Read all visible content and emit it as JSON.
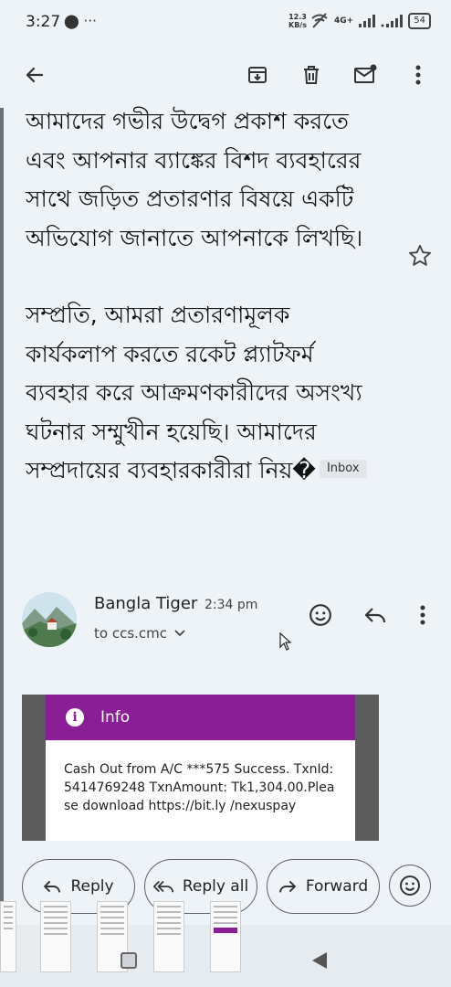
{
  "status_bar": {
    "time": "3:27",
    "left_icons": "⬤ ···",
    "speed_value": "12.3",
    "speed_unit": "KB/s",
    "network_label": "4G+",
    "battery": "54"
  },
  "toolbar": {
    "back_icon": "arrow-back-icon",
    "archive_icon": "archive-icon",
    "delete_icon": "delete-icon",
    "mark_unread_icon": "mark-unread-icon",
    "more_icon": "more-vert-icon"
  },
  "message": {
    "para1": "আমাদের গভীর উদ্বেগ প্রকাশ করতে এবং আপনার ব্যাঙ্কের বিশদ ব্যবহারের সাথে জড়িত প্রতারণার বিষয়ে একটি অভিযোগ জানাতে আপনাকে লিখছি।",
    "para2": "সম্প্রতি, আমরা প্রতারণামূলক কার্যকলাপ করতে রকেট প্ল্যাটফর্ম ব্যবহার করে আক্রমণকারীদের অসংখ্য ঘটনার সম্মুখীন হয়েছি। আমাদের সম্প্রদায়ের ব্যবহারকারীরা নিয়�",
    "label_chip": "Inbox"
  },
  "sender": {
    "name": "Bangla Tiger",
    "time": "2:34 pm",
    "to": "to ccs.cmc"
  },
  "attachment": {
    "header": "Info",
    "info_glyph": "i",
    "text": "Cash Out from A/C ***575 Success. TxnId:5414769248 TxnAmount: Tk1,304.00.Please download https://bit.ly /nexuspay"
  },
  "actions": {
    "reply": "Reply",
    "reply_all": "Reply all",
    "forward": "Forward"
  },
  "colors": {
    "accent_purple": "#8a1e97",
    "background": "#eef3f8"
  }
}
